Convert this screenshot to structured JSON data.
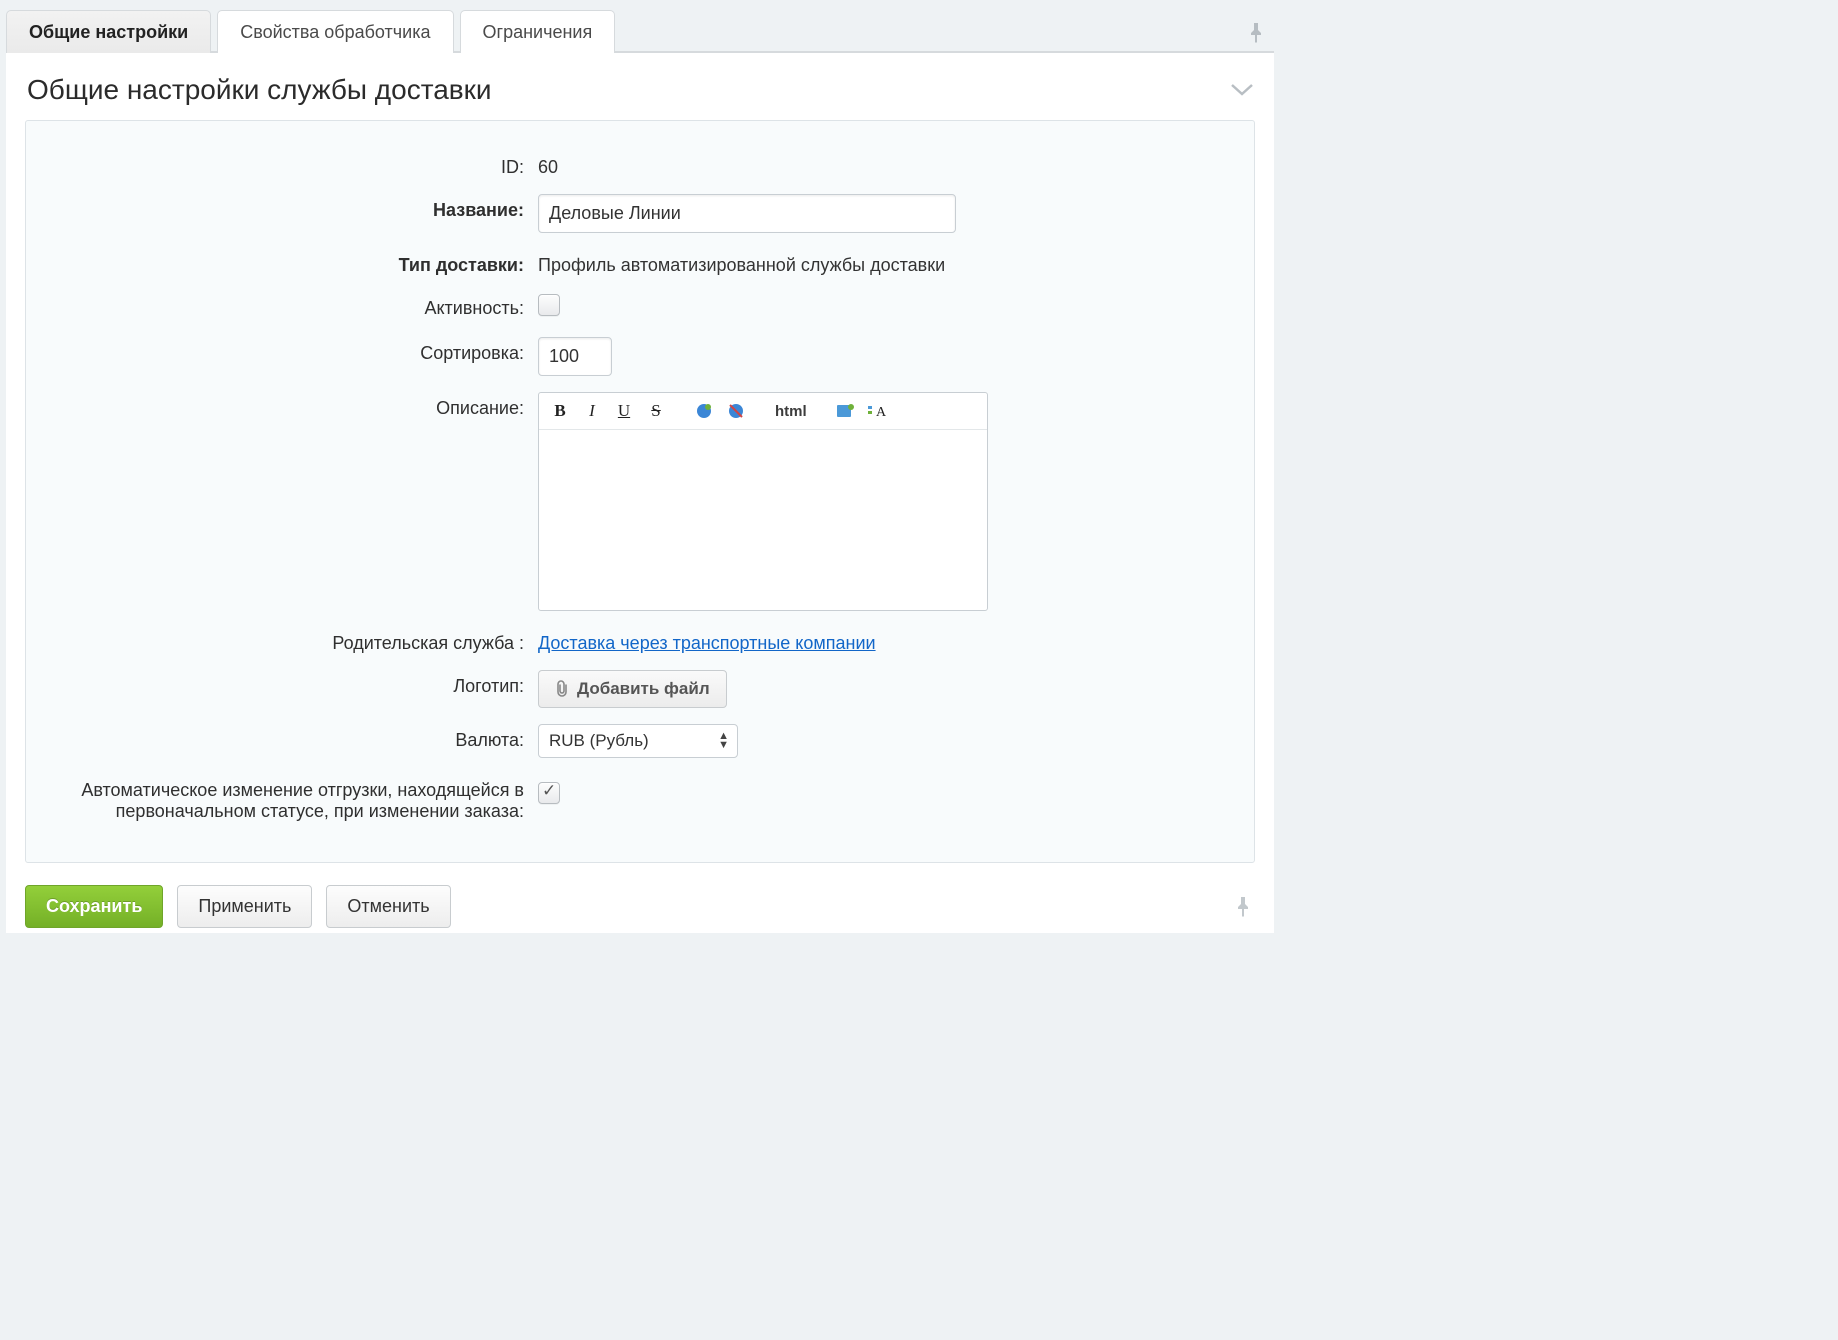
{
  "tabs": {
    "general": "Общие настройки",
    "handler": "Свойства обработчика",
    "restrictions": "Ограничения"
  },
  "panel_title": "Общие настройки службы доставки",
  "labels": {
    "id": "ID:",
    "name": "Название:",
    "delivery_type": "Тип доставки:",
    "active": "Активность:",
    "sort": "Сортировка:",
    "description": "Описание:",
    "parent": "Родительская служба :",
    "logo": "Логотип:",
    "currency": "Валюта:",
    "auto_change": "Автоматическое изменение отгрузки, находящейся в первоначальном статусе, при изменении заказа:"
  },
  "values": {
    "id": "60",
    "name": "Деловые Линии",
    "delivery_type": "Профиль автоматизированной службы доставки",
    "sort": "100",
    "parent_link": "Доставка через транспортные компании",
    "currency": "RUB (Рубль)"
  },
  "editor_toolbar_html": "html",
  "buttons": {
    "add_file": "Добавить файл",
    "save": "Сохранить",
    "apply": "Применить",
    "cancel": "Отменить"
  },
  "checks": {
    "active": false,
    "auto_change": true
  }
}
